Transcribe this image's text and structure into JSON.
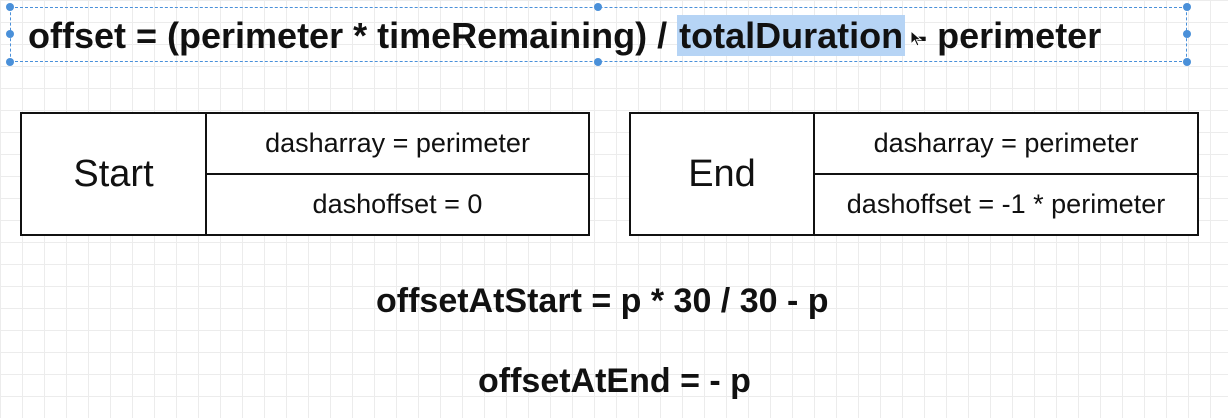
{
  "main_formula": {
    "before": "offset = (perimeter * timeRemaining) / ",
    "selected": "totalDuration",
    "after": " - perimeter"
  },
  "colors": {
    "selection": "#b6d4f5",
    "handles": "#4a90d9"
  },
  "tables": {
    "start": {
      "label": "Start",
      "dasharray": "dasharray = perimeter",
      "dashoffset": "dashoffset = 0"
    },
    "end": {
      "label": "End",
      "dasharray": "dasharray = perimeter",
      "dashoffset": "dashoffset = -1 * perimeter"
    }
  },
  "formulas": {
    "offset_at_start": "offsetAtStart = p * 30 / 30 - p",
    "offset_at_end": "offsetAtEnd = - p"
  },
  "icons": [
    "mouse-cursor-icon"
  ]
}
